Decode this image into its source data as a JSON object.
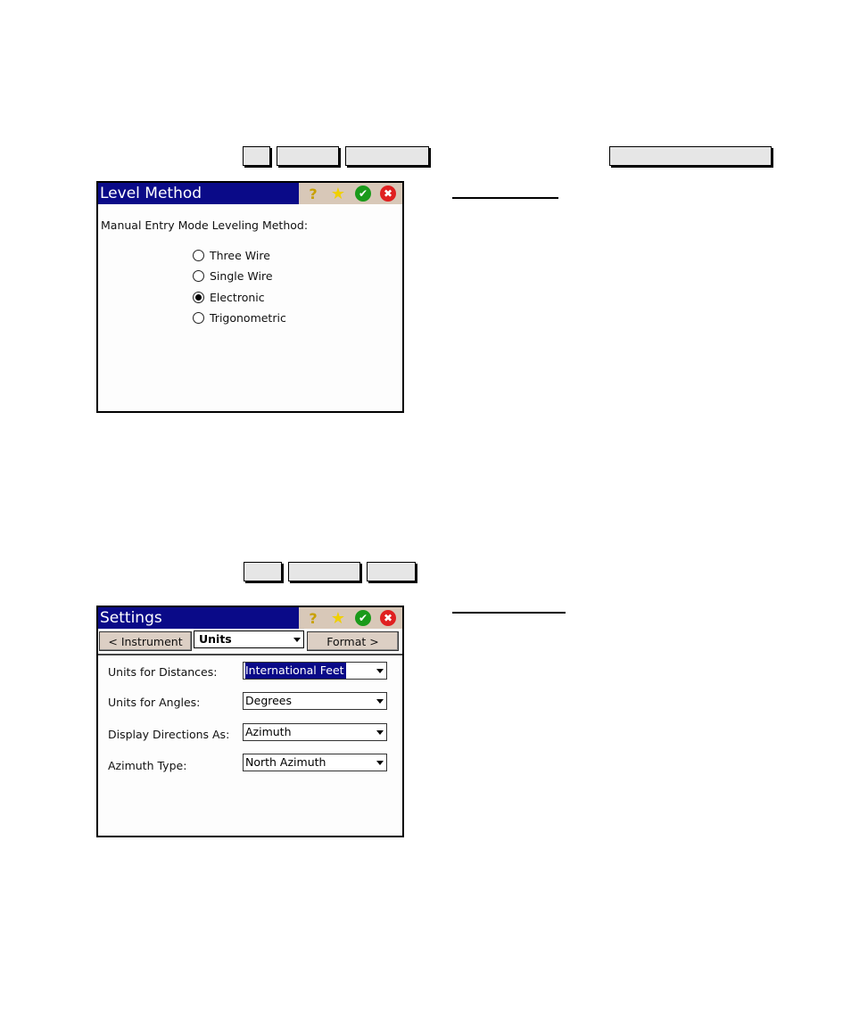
{
  "top_keys": [
    {
      "name": "key-1",
      "label": ""
    },
    {
      "name": "key-2",
      "label": ""
    },
    {
      "name": "key-3",
      "label": ""
    },
    {
      "name": "key-4",
      "label": ""
    }
  ],
  "level_method": {
    "title": "Level Method",
    "toolbar_icons": [
      "help-icon",
      "favorites-star-icon",
      "ok-check-icon",
      "cancel-x-icon"
    ],
    "prompt": "Manual Entry Mode Leveling Method:",
    "options": [
      {
        "label": "Three Wire",
        "selected": false
      },
      {
        "label": "Single Wire",
        "selected": false
      },
      {
        "label": "Electronic",
        "selected": true
      },
      {
        "label": "Trigonometric",
        "selected": false
      }
    ]
  },
  "bottom_keys": [
    {
      "name": "key-5",
      "label": ""
    },
    {
      "name": "key-6",
      "label": ""
    },
    {
      "name": "key-7",
      "label": ""
    }
  ],
  "settings": {
    "title": "Settings",
    "prev_button": "< Instrument",
    "tab_selected": "Units",
    "next_button": "Format >",
    "fields": [
      {
        "label": "Units for Distances:",
        "value": "International Feet",
        "highlighted": true
      },
      {
        "label": "Units for Angles:",
        "value": "Degrees",
        "highlighted": false
      },
      {
        "label": "Display Directions As:",
        "value": "Azimuth",
        "highlighted": false
      },
      {
        "label": "Azimuth Type:",
        "value": "North Azimuth",
        "highlighted": false
      }
    ]
  },
  "icons": {
    "help": "?",
    "star": "★",
    "ok": "✔",
    "cancel": "✖"
  }
}
